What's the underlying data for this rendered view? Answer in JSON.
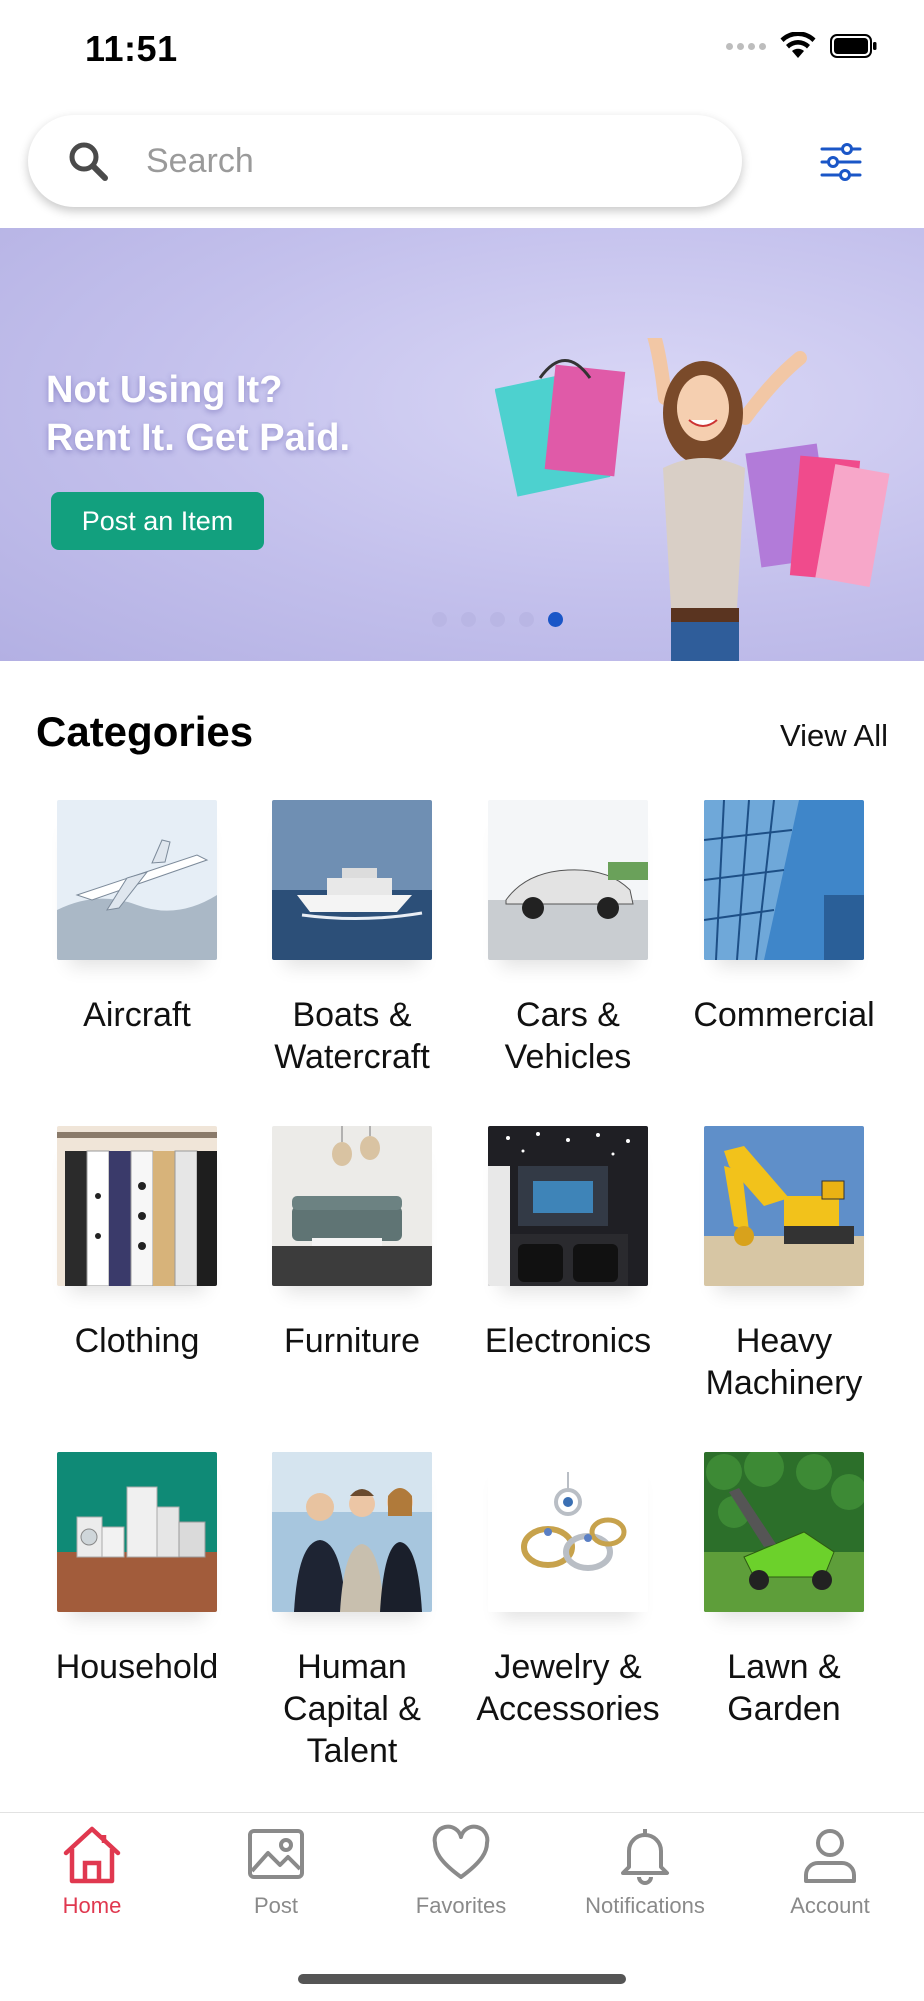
{
  "status_bar": {
    "time": "11:51"
  },
  "search": {
    "placeholder": "Search",
    "value": ""
  },
  "banner": {
    "headline_line1": "Not Using It?",
    "headline_line2": "Rent It. Get Paid.",
    "cta_label": "Post an Item",
    "slide_count": 5,
    "active_slide": 5
  },
  "categories": {
    "title": "Categories",
    "view_all_label": "View All",
    "items": [
      {
        "label": "Aircraft",
        "icon": "aircraft-photo"
      },
      {
        "label": "Boats &\nWatercraft",
        "icon": "boat-photo"
      },
      {
        "label": "Cars &\nVehicles",
        "icon": "car-photo"
      },
      {
        "label": "Commercial",
        "icon": "building-photo"
      },
      {
        "label": "Clothing",
        "icon": "clothing-rack-photo"
      },
      {
        "label": "Furniture",
        "icon": "living-room-photo"
      },
      {
        "label": "Electronics",
        "icon": "home-theater-photo"
      },
      {
        "label": "Heavy\nMachinery",
        "icon": "excavator-photo"
      },
      {
        "label": "Household",
        "icon": "appliances-photo"
      },
      {
        "label": "Human\nCapital &\nTalent",
        "icon": "business-people-photo"
      },
      {
        "label": "Jewelry &\nAccessories",
        "icon": "rings-photo"
      },
      {
        "label": "Lawn &\nGarden",
        "icon": "lawn-mower-photo"
      }
    ]
  },
  "tab_bar": {
    "items": [
      {
        "label": "Home",
        "icon": "home-icon",
        "active": true
      },
      {
        "label": "Post",
        "icon": "image-icon",
        "active": false
      },
      {
        "label": "Favorites",
        "icon": "heart-icon",
        "active": false
      },
      {
        "label": "Notifications",
        "icon": "bell-icon",
        "active": false
      },
      {
        "label": "Account",
        "icon": "person-icon",
        "active": false
      }
    ]
  },
  "colors": {
    "accent_green": "#12a07e",
    "active_tab": "#e0384f",
    "inactive_tab": "#8a8a8a",
    "filter_icon": "#1a56c7",
    "carousel_active": "#1a56c7"
  }
}
